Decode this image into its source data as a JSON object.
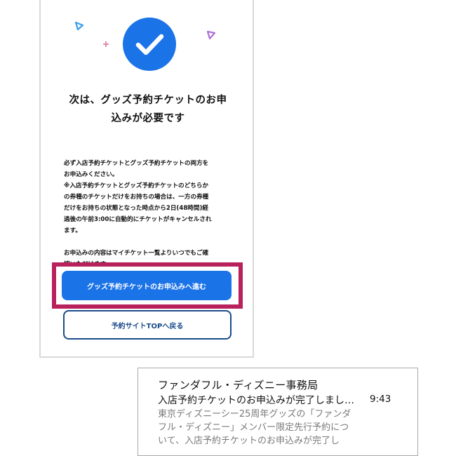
{
  "dialog": {
    "title_lines": [
      "次は、グッズ予約チケットのお申",
      "込みが必要です"
    ],
    "body_lines": [
      "必ず入店予約チケットとグッズ予約チケットの両方を",
      "お申込みください。",
      "※入店予約チケットとグッズ予約チケットのどちらか",
      "の券種のチケットだけをお持ちの場合は、一方の券種",
      "だけをお持ちの状態となった時点から2日(48時間)経",
      "過後の午前3:00に自動的にチケットがキャンセルされ",
      "ます。",
      "",
      "お申込みの内容はマイチケット一覧よりいつでもご確",
      "認いただけます。"
    ],
    "primary_button": "グッズ予約チケットのお申込みへ進む",
    "secondary_button": "予約サイトTOPへ戻る",
    "icons": {
      "main": "checkmark-circle-icon",
      "confetti": [
        "triangle-confetti-icon",
        "plus-confetti-icon",
        "triangle-confetti-icon"
      ]
    },
    "colors": {
      "accent": "#1b73e8",
      "highlight": "#b8215b",
      "outline_button": "#1b4b8a"
    }
  },
  "notification": {
    "sender": "ファンダフル・ディズニー事務局",
    "subject": "入店予約チケットのお申込みが完了しまし…",
    "time": "9:43",
    "preview_lines": [
      "東京ディズニーシー25周年グッズの「ファンダ",
      "フル・ディズニー」メンバー限定先行予約につ",
      "いて、入店予約チケットのお申込みが完了し"
    ]
  }
}
